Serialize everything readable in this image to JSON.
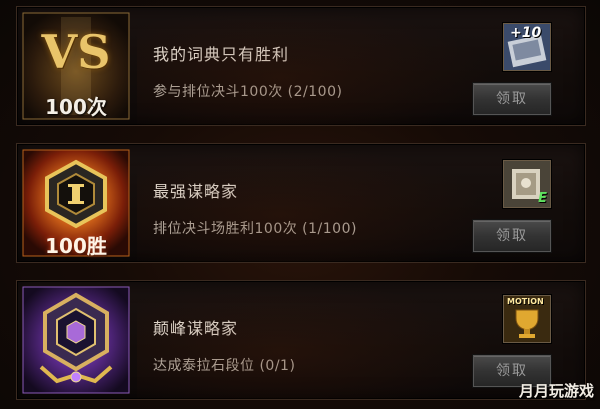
{
  "achievements": [
    {
      "badge_text": "100次",
      "badge_glyph": "VS",
      "title": "我的词典只有胜利",
      "description": "参与排位决斗100次 (2/100)",
      "reward_icon": "plus10-enhance-ticket-icon",
      "reward_label": "+10",
      "claim_label": "领取"
    },
    {
      "badge_text": "100胜",
      "title": "最强谋略家",
      "description": "排位决斗场胜利100次 (1/100)",
      "reward_icon": "stone-token-icon",
      "reward_label": "E",
      "claim_label": "领取"
    },
    {
      "title": "颠峰谋略家",
      "description": "达成泰拉石段位 (0/1)",
      "reward_icon": "motion-trophy-icon",
      "reward_label": "MOTION",
      "claim_label": "领取"
    }
  ],
  "watermark": "月月玩游戏",
  "colors": {
    "gold": "#e3b341",
    "red_badge": "#c2401a",
    "purple_badge": "#7a3fb0"
  }
}
